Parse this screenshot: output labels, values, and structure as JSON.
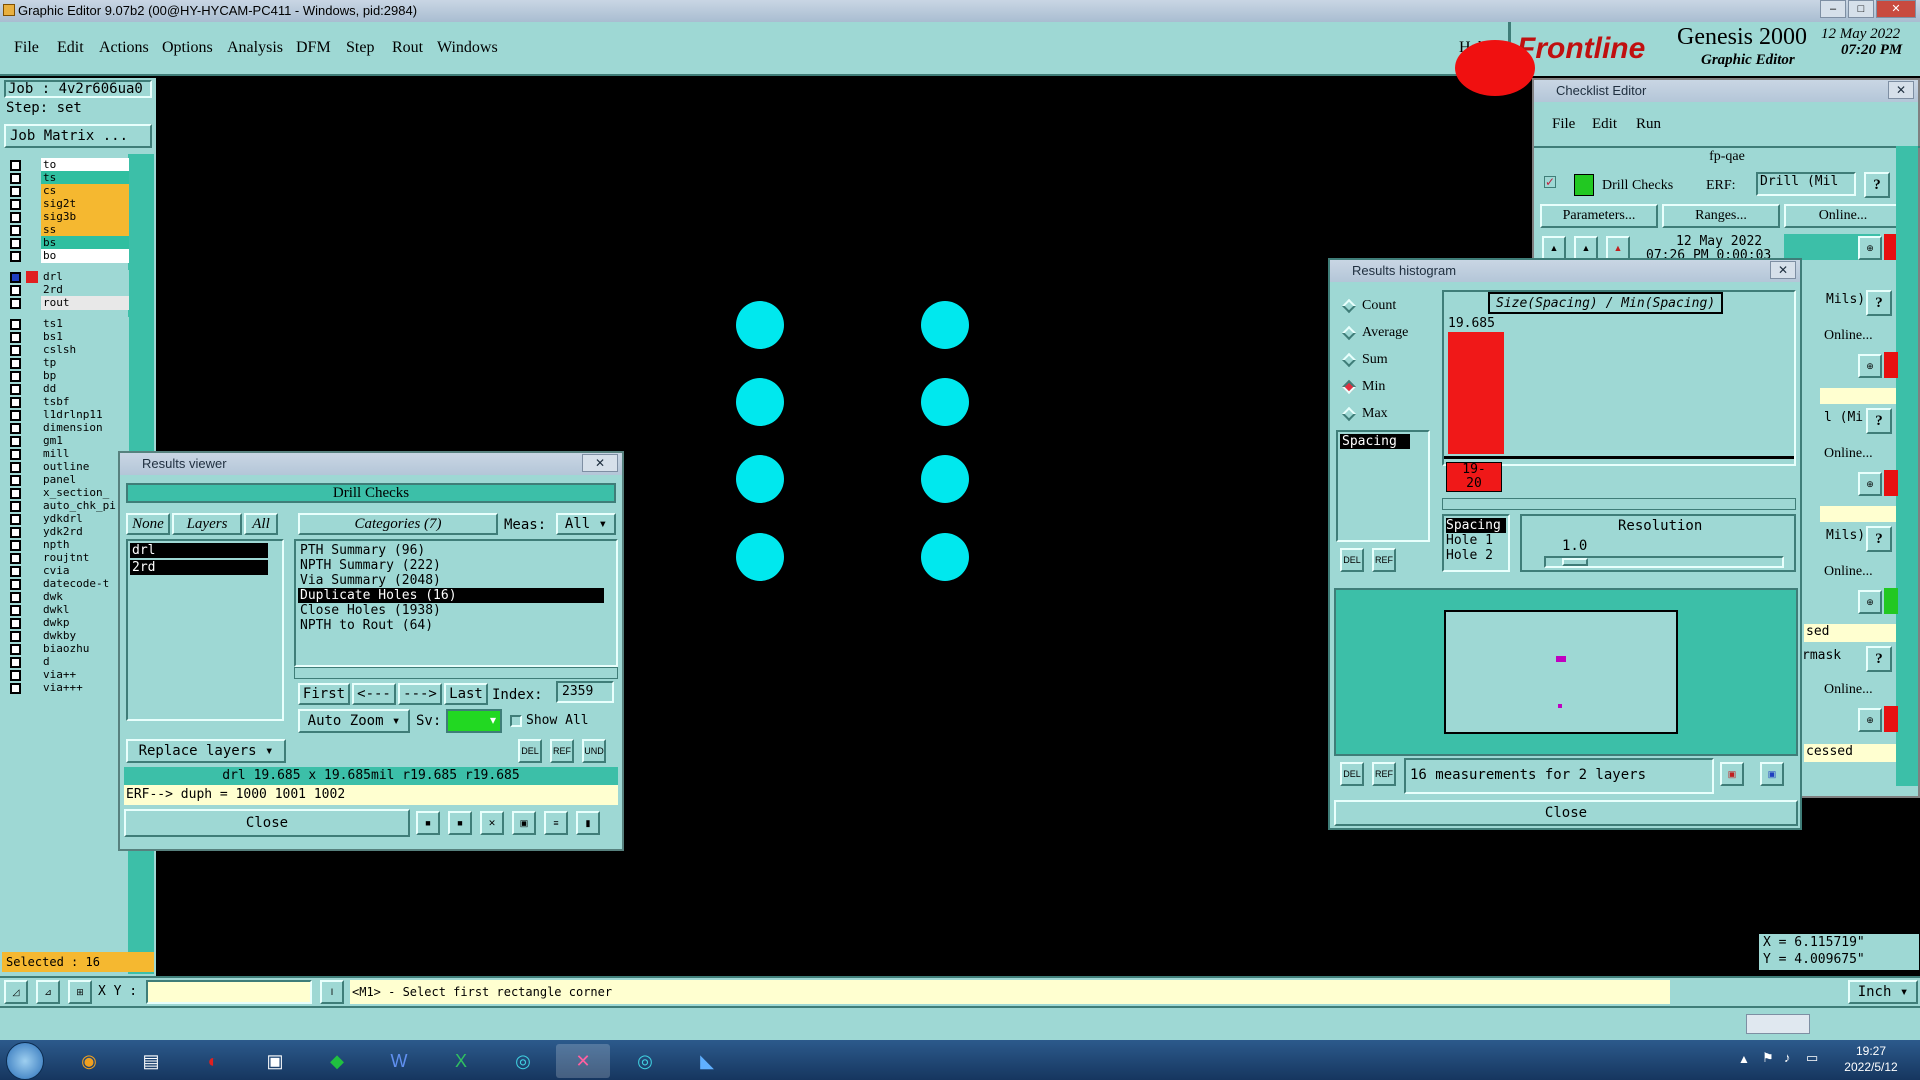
{
  "app_title": "Graphic Editor 9.07b2 (00@HY-HYCAM-PC411 - Windows, pid:2984)",
  "menu": [
    "File",
    "Edit",
    "Actions",
    "Options",
    "Analysis",
    "DFM",
    "Step",
    "Rout",
    "Windows"
  ],
  "help_label": "Help",
  "brand": {
    "logo": "Frontline",
    "product": "Genesis 2000",
    "subtitle": "Graphic Editor",
    "date": "12 May 2022",
    "time": "07:20 PM"
  },
  "left": {
    "job": "Job : 4v2r606ua0",
    "step": "Step: set",
    "matrix_btn": "Job Matrix ...",
    "layers": [
      {
        "name": "to",
        "color": "#ffffff"
      },
      {
        "name": "ts",
        "color": "#2fbfa0"
      },
      {
        "name": "cs",
        "color": "#f5b830"
      },
      {
        "name": "sig2t",
        "color": "#f5b830"
      },
      {
        "name": "sig3b",
        "color": "#f5b830"
      },
      {
        "name": "ss",
        "color": "#f5b830"
      },
      {
        "name": "bs",
        "color": "#2fbfa0"
      },
      {
        "name": "bo",
        "color": "#ffffff"
      },
      {
        "name": "drl",
        "color": "#9ed8d4"
      },
      {
        "name": "2rd",
        "color": "#9ed8d4"
      },
      {
        "name": "rout",
        "color": "#e8e8e8"
      },
      {
        "name": "ts1",
        "color": "#9ed8d4"
      },
      {
        "name": "bs1",
        "color": "#9ed8d4"
      },
      {
        "name": "cslsh",
        "color": "#9ed8d4"
      },
      {
        "name": "tp",
        "color": "#9ed8d4"
      },
      {
        "name": "bp",
        "color": "#9ed8d4"
      },
      {
        "name": "dd",
        "color": "#9ed8d4"
      },
      {
        "name": "tsbf",
        "color": "#9ed8d4"
      },
      {
        "name": "l1drlnp11",
        "color": "#9ed8d4"
      },
      {
        "name": "dimension",
        "color": "#9ed8d4"
      },
      {
        "name": "gm1",
        "color": "#9ed8d4"
      },
      {
        "name": "mill",
        "color": "#9ed8d4"
      },
      {
        "name": "outline",
        "color": "#9ed8d4"
      },
      {
        "name": "panel",
        "color": "#9ed8d4"
      },
      {
        "name": "x_section_",
        "color": "#9ed8d4"
      },
      {
        "name": "auto_chk_pi",
        "color": "#9ed8d4"
      },
      {
        "name": "ydkdrl",
        "color": "#9ed8d4"
      },
      {
        "name": "ydk2rd",
        "color": "#9ed8d4"
      },
      {
        "name": "npth",
        "color": "#9ed8d4"
      },
      {
        "name": "roujtnt",
        "color": "#9ed8d4"
      },
      {
        "name": "cvia",
        "color": "#9ed8d4"
      },
      {
        "name": "datecode-t",
        "color": "#9ed8d4"
      },
      {
        "name": "dwk",
        "color": "#9ed8d4"
      },
      {
        "name": "dwkl",
        "color": "#9ed8d4"
      },
      {
        "name": "dwkp",
        "color": "#9ed8d4"
      },
      {
        "name": "dwkby",
        "color": "#9ed8d4"
      },
      {
        "name": "biaozhu",
        "color": "#9ed8d4"
      },
      {
        "name": "d",
        "color": "#9ed8d4"
      },
      {
        "name": "via++",
        "color": "#9ed8d4"
      },
      {
        "name": "via+++",
        "color": "#9ed8d4"
      }
    ],
    "selected": "Selected : 16"
  },
  "results_viewer": {
    "title": "Results viewer",
    "header": "Drill Checks",
    "none": "None",
    "layers": "Layers",
    "all": "All",
    "categories": "Categories (7)",
    "meas_label": "Meas:",
    "meas_value": "All",
    "layer_items": [
      "drl",
      "2rd"
    ],
    "category_items": [
      "PTH Summary (96)",
      "NPTH Summary (222)",
      "Via Summary (2048)",
      "Duplicate Holes (16)",
      "Close Holes (1938)",
      "NPTH to Rout (64)"
    ],
    "first": "First",
    "prev": "<---",
    "next": "--->",
    "last": "Last",
    "index_label": "Index:",
    "index_value": "2359",
    "auto_zoom": "Auto Zoom",
    "sv_label": "Sv:",
    "show_all": "Show All",
    "replace_layers": "Replace layers",
    "info": "drl 19.685 x 19.685mil  r19.685  r19.685",
    "erf": "ERF--> duph = 1000 1001 1002",
    "close": "Close"
  },
  "histogram": {
    "title": "Results histogram",
    "options": [
      "Count",
      "Average",
      "Sum",
      "Min",
      "Max"
    ],
    "selected_option": "Min",
    "list_item": "Spacing",
    "chart_title": "Size(Spacing) / Min(Spacing)",
    "bar_value_label": "19.685",
    "bin_label": "19-\n20",
    "res_items": [
      "Spacing",
      "Hole 1",
      "Hole 2"
    ],
    "resolution_label": "Resolution",
    "resolution_value": "1.0",
    "status": "16 measurements for 2 layers",
    "close": "Close"
  },
  "checklist": {
    "title": "Checklist Editor",
    "menu": [
      "File",
      "Edit",
      "Run"
    ],
    "name": "fp-qae",
    "drill_checks": "Drill Checks",
    "erf_label": "ERF:",
    "erf_value": "Drill (Mil",
    "parameters": "Parameters...",
    "ranges": "Ranges...",
    "online": "Online...",
    "date": "12 May 2022",
    "time_partial": "07:26 PM  0:00:03",
    "side_texts": [
      "Mils)",
      "Online...",
      "l (Mi",
      "Online...",
      "Mils)",
      "Online...",
      "sed",
      "rmask",
      "Online...",
      "cessed"
    ]
  },
  "coords": {
    "x": "X = 6.115719\"",
    "y": "Y = 4.009675\""
  },
  "bottom": {
    "xy_label": "X Y :",
    "prompt": "<M1> - Select first rectangle corner",
    "units": "Inch"
  },
  "taskbar": {
    "time": "19:27",
    "date": "2022/5/12"
  }
}
